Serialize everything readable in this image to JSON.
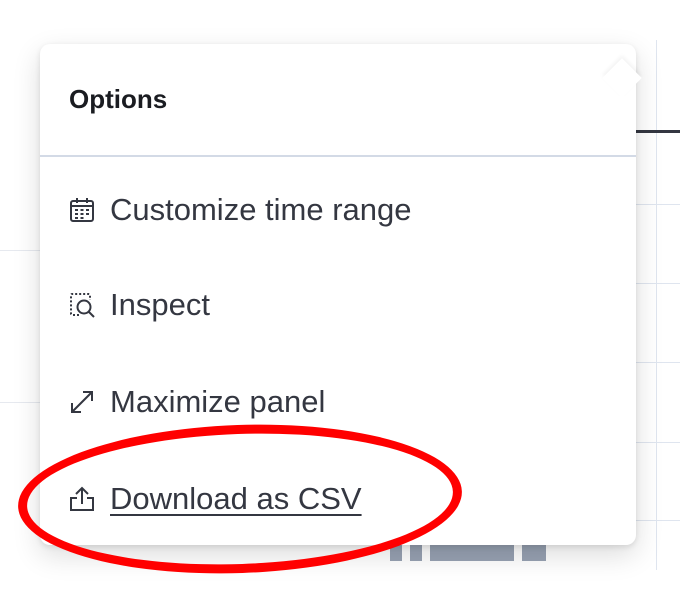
{
  "popover": {
    "title": "Options",
    "items": [
      {
        "label": "Customize time range",
        "icon": "calendar-icon"
      },
      {
        "label": "Inspect",
        "icon": "inspect-icon"
      },
      {
        "label": "Maximize panel",
        "icon": "maximize-icon"
      },
      {
        "label": "Download as CSV",
        "icon": "share-upload-icon"
      }
    ]
  },
  "annotation": {
    "color": "#ff0000",
    "target": "Download as CSV"
  },
  "colors": {
    "text": "#343741",
    "title": "#1a1c21",
    "divider": "#d3dae6"
  }
}
